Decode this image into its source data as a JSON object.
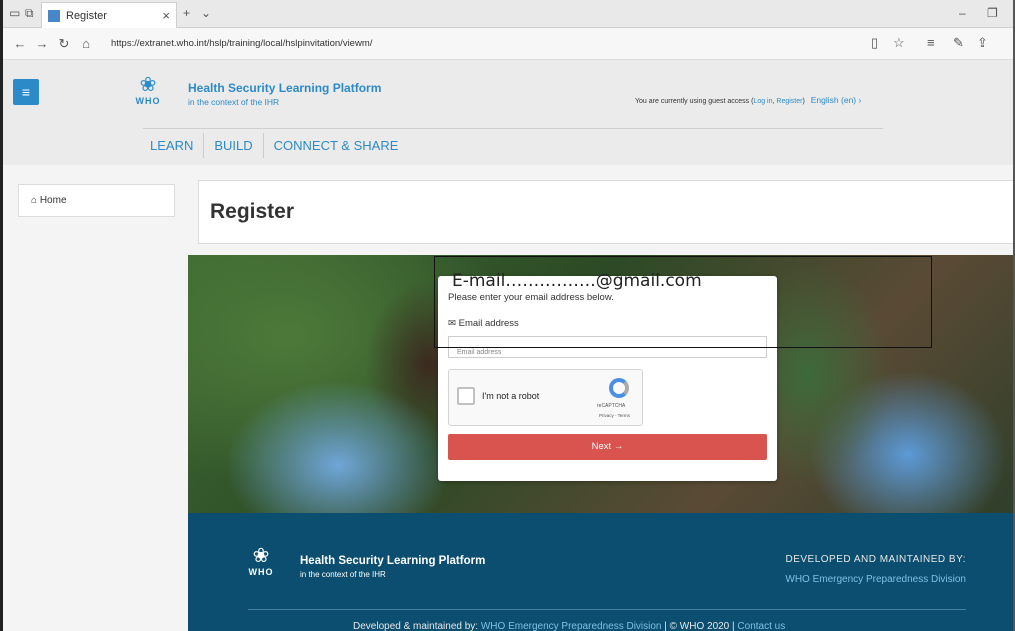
{
  "browser": {
    "tab_title": "Register",
    "tab_close": "×",
    "url": "https://extranet.who.int/hslp/training/local/hslpinvitation/viewm/"
  },
  "site": {
    "brand_title": "Health Security Learning Platform",
    "brand_sub": "in the context of the IHR",
    "who_text": "WHO",
    "guest_prefix": "You are currently using guest access (",
    "login_link": "Log in",
    "register_link": "Register",
    "guest_suffix": ")",
    "language": "English (en) ›",
    "nav": [
      "LEARN",
      "BUILD",
      "CONNECT & SHARE"
    ]
  },
  "sidebar": {
    "home": "Home"
  },
  "page": {
    "title": "Register"
  },
  "form": {
    "intro": "Please enter your email address below.",
    "email_label": "Email address",
    "email_placeholder": "Email address",
    "captcha_label": "I'm not a robot",
    "captcha_brand": "reCAPTCHA",
    "captcha_links": "Privacy - Terms",
    "next_label": "Next →"
  },
  "annotation": {
    "text": "E-mail…………….@gmail.com"
  },
  "footer": {
    "title": "Health Security Learning Platform",
    "sub": "in the context of the IHR",
    "who_text": "WHO",
    "developed": "DEVELOPED AND MAINTAINED BY:",
    "division": "WHO Emergency Preparedness Division",
    "bottom_prefix": "Developed & maintained by: ",
    "bottom_link": "WHO Emergency Preparedness Division",
    "bottom_suffix": " | © WHO 2020 | ",
    "contact": "Contact us"
  },
  "colors": {
    "accent": "#2d8ac8",
    "next_button": "#d9534f",
    "footer_bg": "#0b4e70"
  }
}
